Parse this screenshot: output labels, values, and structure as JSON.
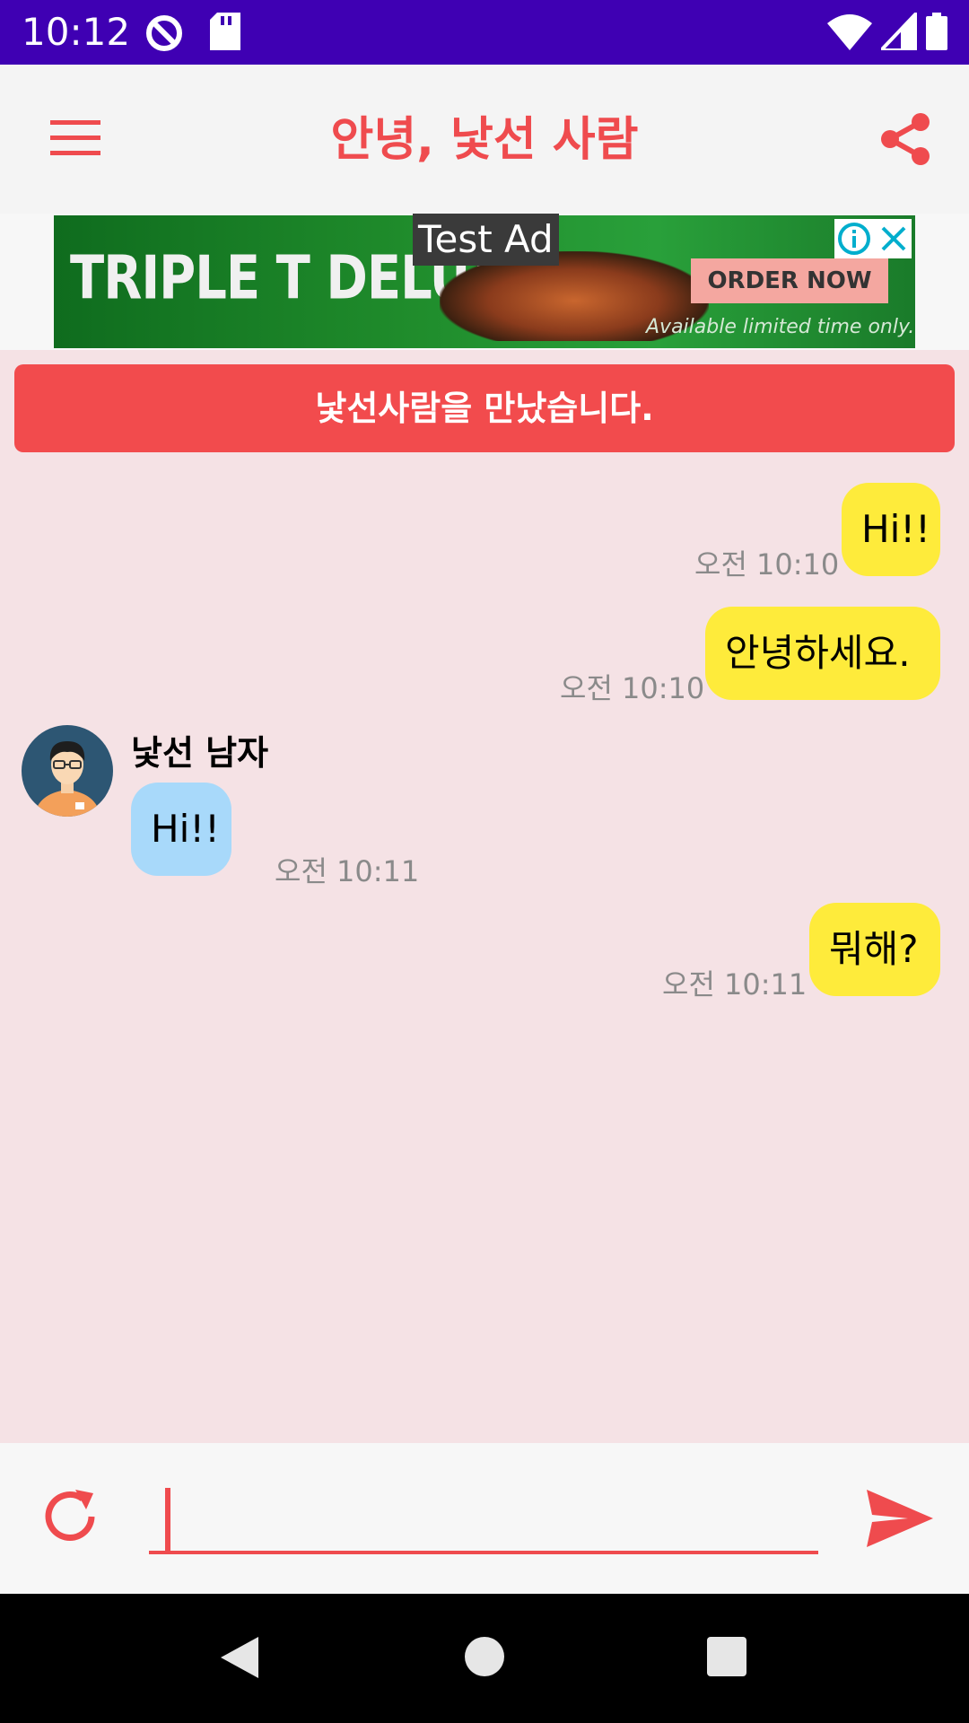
{
  "status_bar": {
    "time": "10:12"
  },
  "app_bar": {
    "title": "안녕, 낯선 사람",
    "menu_icon": "hamburger-menu-icon",
    "share_icon": "share-icon"
  },
  "ad": {
    "label": "Test Ad",
    "brand": "TRIPLE T DELUXE",
    "cta": "ORDER NOW",
    "fine_print": "Available limited time only."
  },
  "notice": {
    "text": "낯선사람을 만났습니다."
  },
  "messages": [
    {
      "side": "mine",
      "text": "Hi!!",
      "time": "오전 10:10"
    },
    {
      "side": "mine",
      "text": "안녕하세요.",
      "time": "오전 10:10"
    },
    {
      "side": "theirs",
      "sender": "낯선 남자",
      "text": "Hi!!",
      "time": "오전 10:11"
    },
    {
      "side": "mine",
      "text": "뭐해?",
      "time": "오전 10:11"
    }
  ],
  "input": {
    "value": "",
    "placeholder": ""
  },
  "colors": {
    "accent": "#ef4b4e",
    "status_bar": "#3f00b3",
    "chat_background": "#f5e2e5",
    "my_bubble": "#feeb3b",
    "their_bubble": "#a8d9fa"
  }
}
